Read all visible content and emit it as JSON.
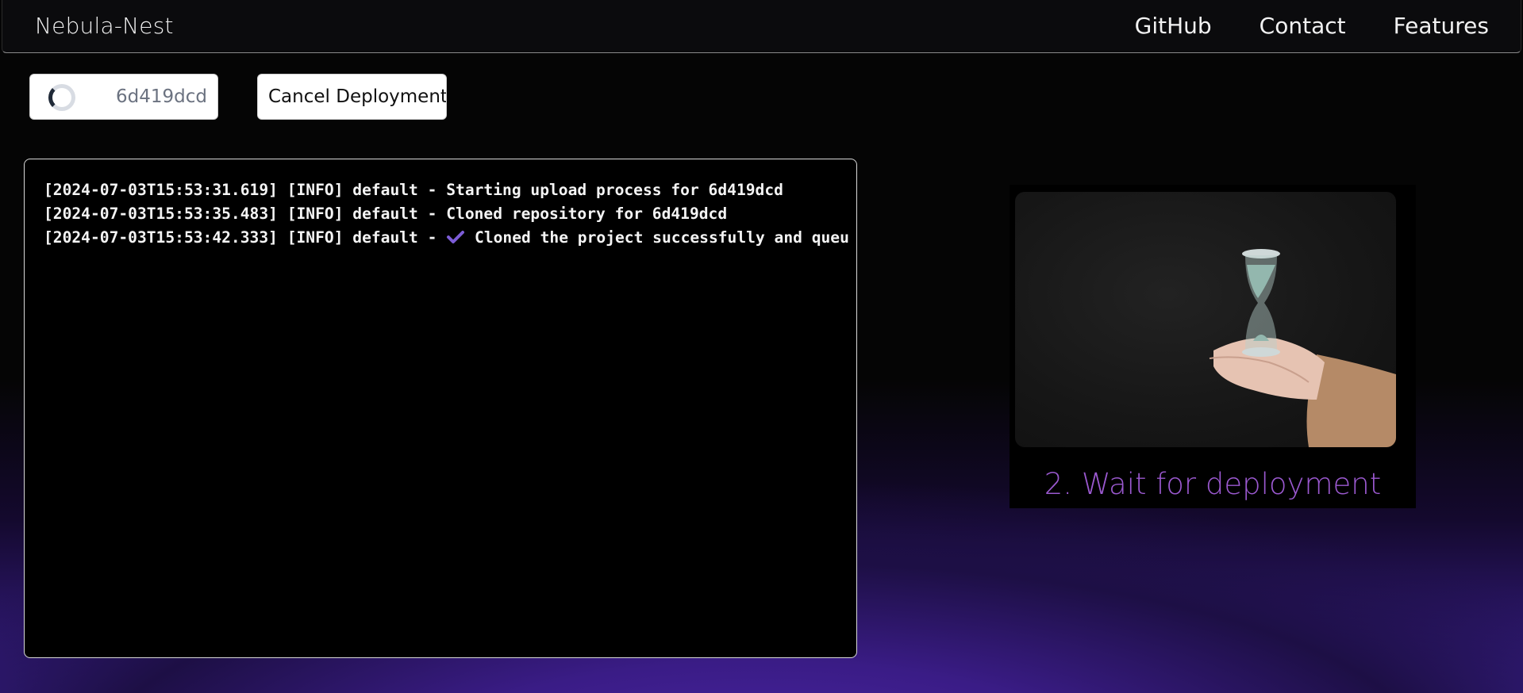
{
  "nav": {
    "brand": "Nebula-Nest",
    "links": [
      "GitHub",
      "Contact",
      "Features"
    ]
  },
  "deployment": {
    "id": "6d419dcd",
    "cancel_label": "Cancel Deployment"
  },
  "logs": [
    {
      "prefix": "[2024-07-03T15:53:31.619] [INFO] default - ",
      "icon": "",
      "message": "Starting upload process for 6d419dcd"
    },
    {
      "prefix": "[2024-07-03T15:53:35.483] [INFO] default - ",
      "icon": "",
      "message": "Cloned repository for 6d419dcd"
    },
    {
      "prefix": "[2024-07-03T15:53:42.333] [INFO] default - ",
      "icon": "check-icon",
      "message": " Cloned the project successfully and queu"
    }
  ],
  "card": {
    "caption": "2. Wait for deployment",
    "image": "hourglass-in-hands"
  },
  "colors": {
    "accent": "#9b59d0",
    "check": "#7c5cd6",
    "background_glow": "#4a24a3"
  }
}
